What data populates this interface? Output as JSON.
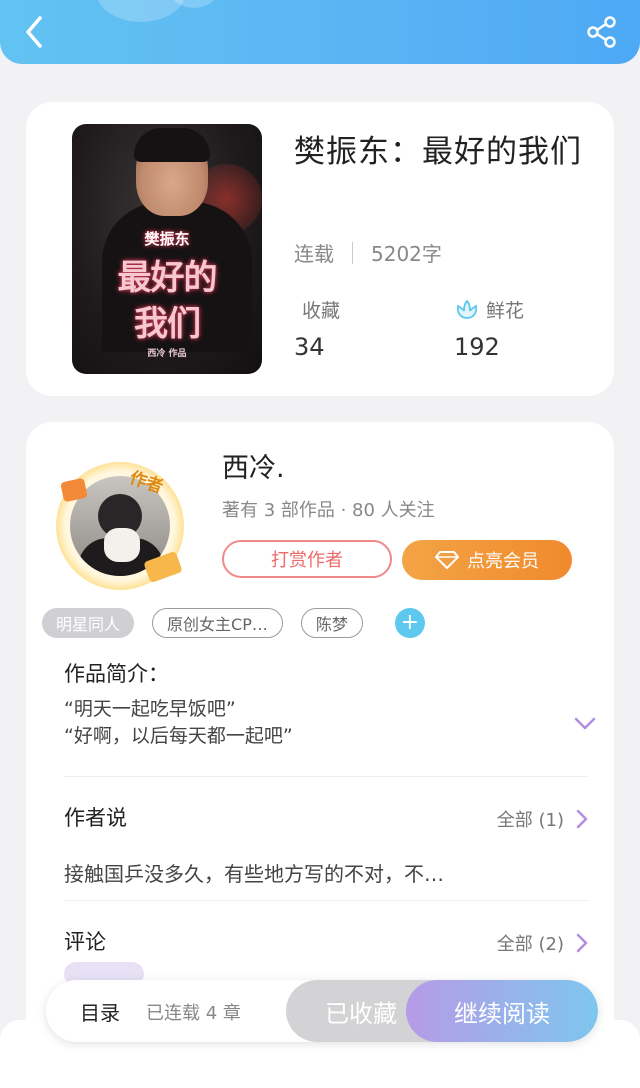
{
  "header": {
    "back_icon": "chevron-left-icon",
    "share_icon": "share-icon"
  },
  "book": {
    "title": "樊振东：最好的我们",
    "status": "连载",
    "word_count": "5202字",
    "cover": {
      "line0": "樊振东",
      "line1": "最好的",
      "line2": "我们",
      "line3": "西冷 作品"
    },
    "stats": [
      {
        "label": "收藏",
        "value": "34",
        "icon": ""
      },
      {
        "label": "鲜花",
        "value": "192",
        "icon": "flower-icon"
      }
    ]
  },
  "author": {
    "name": "西冷.",
    "meta": "著有 3 部作品 · 80 人关注",
    "badge": "作者",
    "tip_label": "打赏作者",
    "vip_label": "点亮会员",
    "vip_icon": "diamond-icon"
  },
  "tags": [
    "明星同人",
    "原创女主CP…",
    "陈梦"
  ],
  "intro": {
    "title": "作品简介：",
    "text": "“明天一起吃早饭吧”\n“好啊，以后每天都一起吧”"
  },
  "author_say": {
    "title": "作者说",
    "all_label": "全部 (1)",
    "text": "接触国乒没多久，有些地方写的不对，不…"
  },
  "comments": {
    "title": "评论",
    "all_label": "全部 (2)"
  },
  "bottom_bar": {
    "toc_label": "目录",
    "chapters": "已连载 4 章",
    "collected_label": "已收藏",
    "continue_label": "继续阅读"
  },
  "colors": {
    "accent_blue": "#5ab4f3",
    "accent_orange": "#f08a2c",
    "accent_purple": "#b69be6",
    "tip_red": "#ee6a6a"
  }
}
